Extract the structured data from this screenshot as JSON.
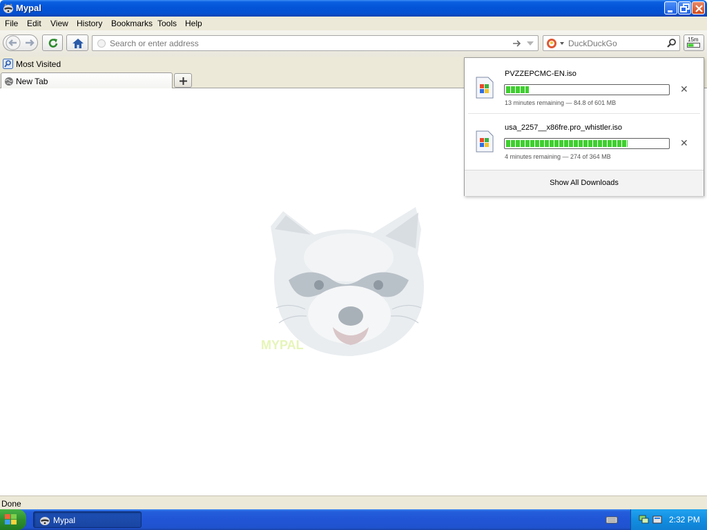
{
  "window": {
    "title": "Mypal"
  },
  "menu": [
    "File",
    "Edit",
    "View",
    "History",
    "Bookmarks",
    "Tools",
    "Help"
  ],
  "toolbar": {
    "url_placeholder": "Search or enter address",
    "search_placeholder": "DuckDuckGo",
    "downloads_badge": "15m"
  },
  "bookmarks": {
    "most_visited": "Most Visited"
  },
  "tabs": [
    {
      "label": "New Tab"
    }
  ],
  "content": {
    "logo_text": "MYPAL"
  },
  "downloads": {
    "items": [
      {
        "filename": "PVZZEPCMC-EN.iso",
        "status": "13 minutes remaining — 84.8 of 601 MB",
        "progress": 0.141
      },
      {
        "filename": "usa_2257__x86fre.pro_whistler.iso",
        "status": "4 minutes remaining — 274 of 364 MB",
        "progress": 0.753
      }
    ],
    "show_all": "Show All Downloads"
  },
  "statusbar": {
    "text": "Done"
  },
  "taskbar": {
    "item_label": "Mypal",
    "clock": "2:32 PM"
  }
}
